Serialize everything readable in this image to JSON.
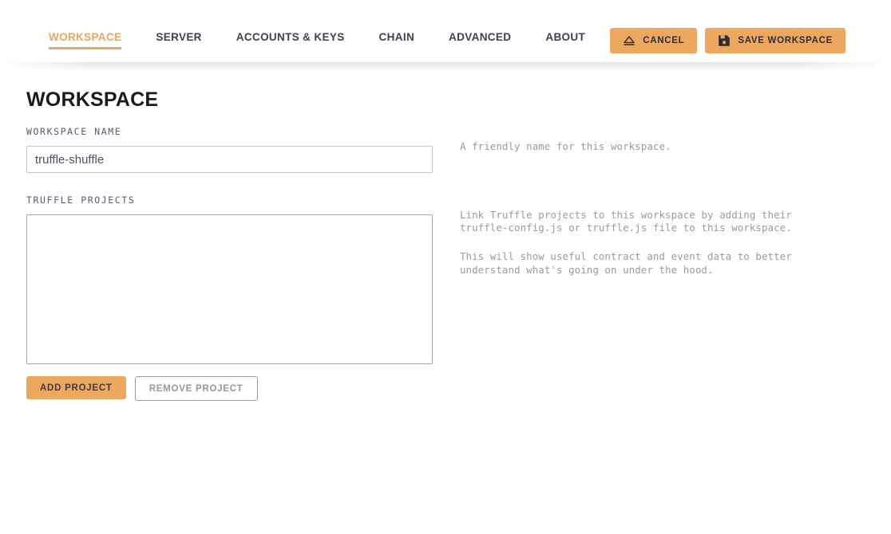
{
  "nav": {
    "tabs": [
      {
        "label": "WORKSPACE",
        "name": "workspace",
        "active": true
      },
      {
        "label": "SERVER",
        "name": "server",
        "active": false
      },
      {
        "label": "ACCOUNTS & KEYS",
        "name": "accounts-keys",
        "active": false
      },
      {
        "label": "CHAIN",
        "name": "chain",
        "active": false
      },
      {
        "label": "ADVANCED",
        "name": "advanced",
        "active": false
      },
      {
        "label": "ABOUT",
        "name": "about",
        "active": false
      }
    ]
  },
  "header_actions": {
    "cancel_label": "CANCEL",
    "cancel_icon": "eject-icon",
    "save_label": "SAVE WORKSPACE",
    "save_icon": "floppy-disk-save-icon"
  },
  "page": {
    "title": "WORKSPACE"
  },
  "workspace_name": {
    "label": "WORKSPACE NAME",
    "value": "truffle-shuffle",
    "placeholder": "",
    "help": "A friendly name for this workspace."
  },
  "truffle_projects": {
    "label": "TRUFFLE PROJECTS",
    "value": "",
    "placeholder": "",
    "help_paragraph_1": "Link Truffle projects to this workspace by adding their\ntruffle-config.js or truffle.js file to this workspace.",
    "help_paragraph_2": "This will show useful contract and event data to better\nunderstand what's going on under the hood.",
    "add_label": "ADD PROJECT",
    "remove_label": "REMOVE PROJECT"
  },
  "colors": {
    "accent_orange": "#eda663",
    "accent_orange_button": "#eda860",
    "text_dark": "#3b4252",
    "help_gray": "#9a9a9a",
    "border_gray": "#a6a6a6"
  }
}
